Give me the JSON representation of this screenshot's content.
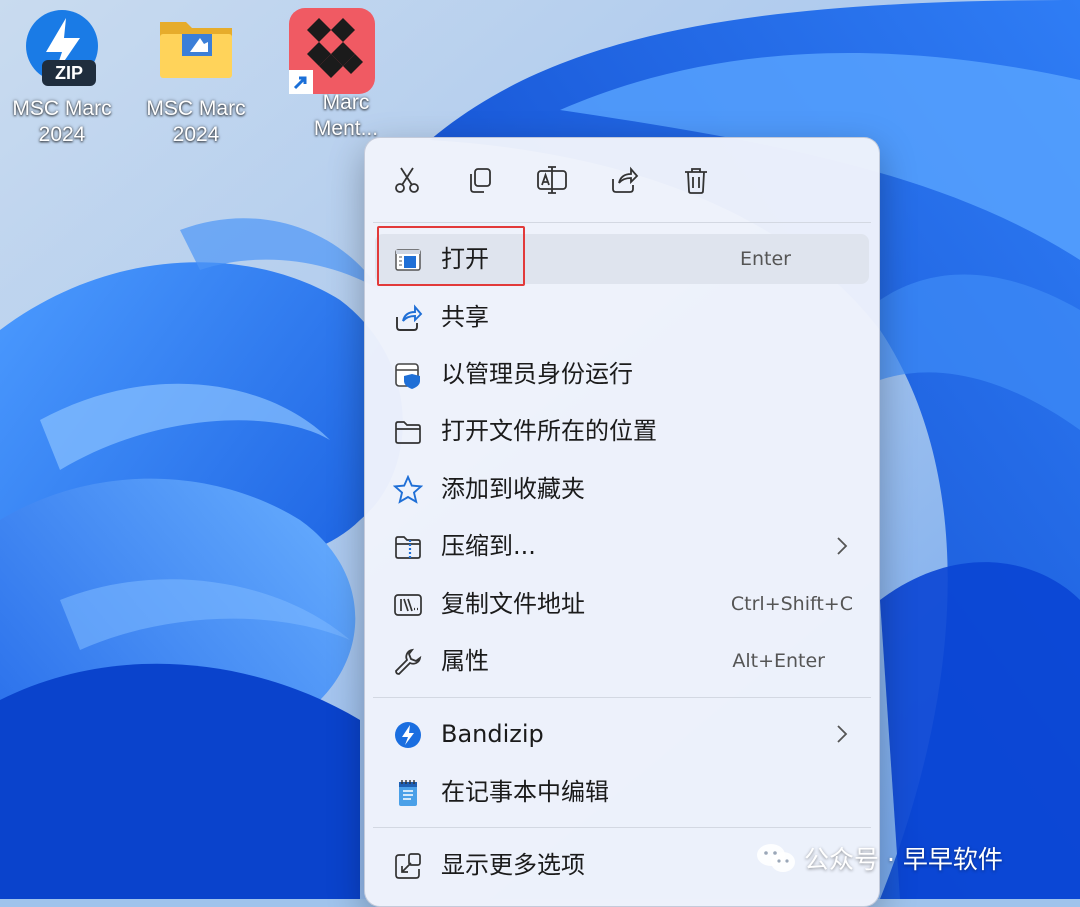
{
  "desktop": {
    "icons": [
      {
        "label_line1": "MSC Marc",
        "label_line2": "2024",
        "icon": "bandizip-zip-icon"
      },
      {
        "label_line1": "MSC Marc",
        "label_line2": "2024",
        "icon": "folder-icon"
      },
      {
        "label_line1": "Marc",
        "label_line2": "Ment...",
        "icon": "marc-mentat-shortcut-icon"
      }
    ],
    "zip_badge": "ZIP"
  },
  "context_menu": {
    "toolbar": [
      {
        "name": "cut",
        "icon": "scissors-icon"
      },
      {
        "name": "copy",
        "icon": "copy-icon"
      },
      {
        "name": "rename",
        "icon": "rename-icon"
      },
      {
        "name": "share",
        "icon": "share-icon"
      },
      {
        "name": "delete",
        "icon": "trash-icon"
      }
    ],
    "items": [
      {
        "label": "打开",
        "shortcut": "Enter",
        "icon": "open-app-icon",
        "highlighted": true
      },
      {
        "label": "共享",
        "shortcut": "",
        "icon": "share-icon"
      },
      {
        "label": "以管理员身份运行",
        "shortcut": "",
        "icon": "run-as-admin-shield-icon"
      },
      {
        "label": "打开文件所在的位置",
        "shortcut": "",
        "icon": "folder-open-icon"
      },
      {
        "label": "添加到收藏夹",
        "shortcut": "",
        "icon": "star-icon"
      },
      {
        "label": "压缩到...",
        "shortcut": "",
        "icon": "zip-folder-icon",
        "submenu": true
      },
      {
        "label": "复制文件地址",
        "shortcut": "Ctrl+Shift+C",
        "icon": "copy-path-icon"
      },
      {
        "label": "属性",
        "shortcut": "Alt+Enter",
        "icon": "wrench-icon"
      }
    ],
    "extra_items": [
      {
        "label": "Bandizip",
        "icon": "bandizip-icon",
        "submenu": true
      },
      {
        "label": "在记事本中编辑",
        "icon": "notepad-icon"
      }
    ],
    "more_options": {
      "label": "显示更多选项",
      "icon": "show-more-icon"
    }
  },
  "watermark": {
    "text": "公众号 · 早早软件"
  },
  "colors": {
    "accent": "#0067c0",
    "highlight_box": "#e23a3a",
    "menu_bg": "#eff3fb",
    "wallpaper_blue": "#1565e0"
  }
}
